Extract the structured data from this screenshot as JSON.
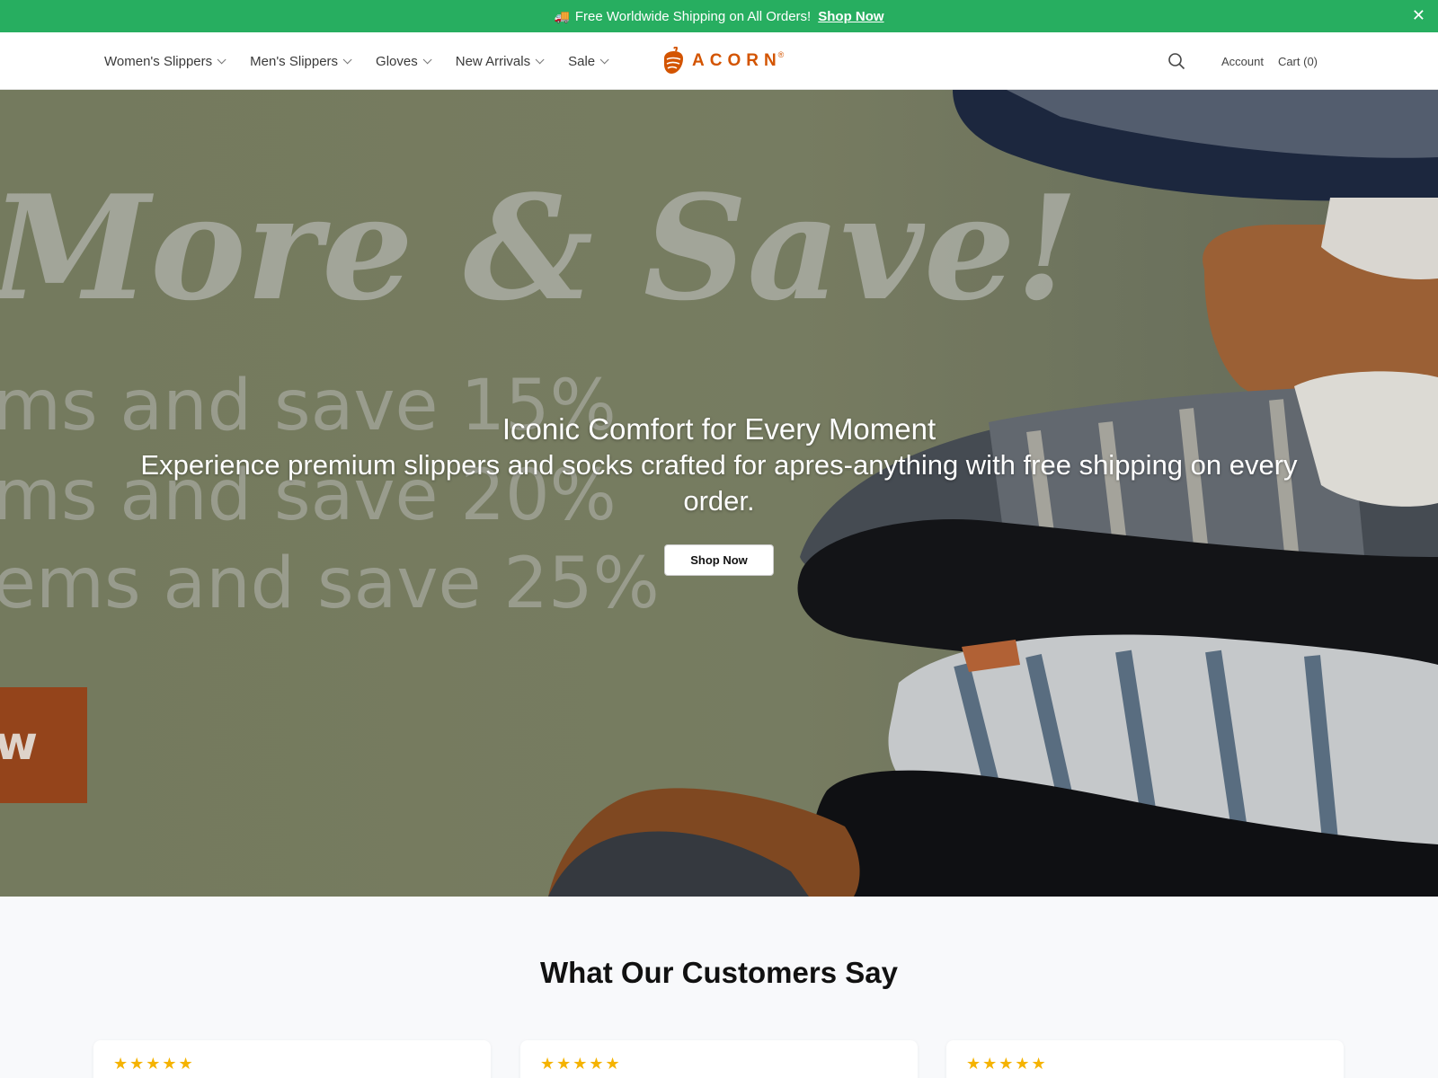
{
  "announcement": {
    "text": "Free Worldwide Shipping on All Orders!",
    "link": "Shop Now"
  },
  "nav": {
    "items": [
      {
        "label": "Women's Slippers"
      },
      {
        "label": "Men's Slippers"
      },
      {
        "label": "Gloves"
      },
      {
        "label": "New Arrivals"
      },
      {
        "label": "Sale"
      }
    ]
  },
  "logo": {
    "text": "ACORN",
    "reg": "®"
  },
  "header": {
    "account": "Account",
    "cart": "Cart (0)"
  },
  "hero": {
    "bg_lines": [
      "More & Save!",
      "ms and save 15%",
      "ms and save 20%",
      "ems and save 25%",
      "w"
    ],
    "title": "Iconic Comfort for Every Moment",
    "subtitle": "Experience premium slippers and socks crafted for apres-anything with free shipping on every order.",
    "button": "Shop Now"
  },
  "reviews": {
    "title": "What Our Customers Say",
    "cards": [
      {
        "stars": "★★★★★"
      },
      {
        "stars": "★★★★★"
      },
      {
        "stars": "★★★★★"
      }
    ]
  },
  "colors": {
    "announce_bg": "#27ae60",
    "brand": "#d35400",
    "star": "#f5b301"
  },
  "icons": {
    "truck": "truck-icon",
    "close": "close-icon",
    "search": "search-icon",
    "chevron": "chevron-down-icon",
    "logo": "acorn-logo-icon"
  }
}
